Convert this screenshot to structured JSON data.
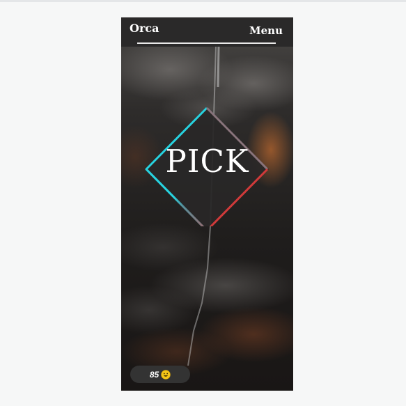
{
  "header": {
    "brand": "Orca",
    "menu_label": "Menu"
  },
  "hero": {
    "pick_label": "PICK"
  },
  "score": {
    "value": "85",
    "emoji_icon": "grinning-face-icon"
  },
  "colors": {
    "diamond_gradient_start": "#27d3e0",
    "diamond_gradient_end": "#d03a3a",
    "header_bg": "#2a2929",
    "pill_bg": "#333333",
    "page_bg": "#f6f7f7"
  }
}
